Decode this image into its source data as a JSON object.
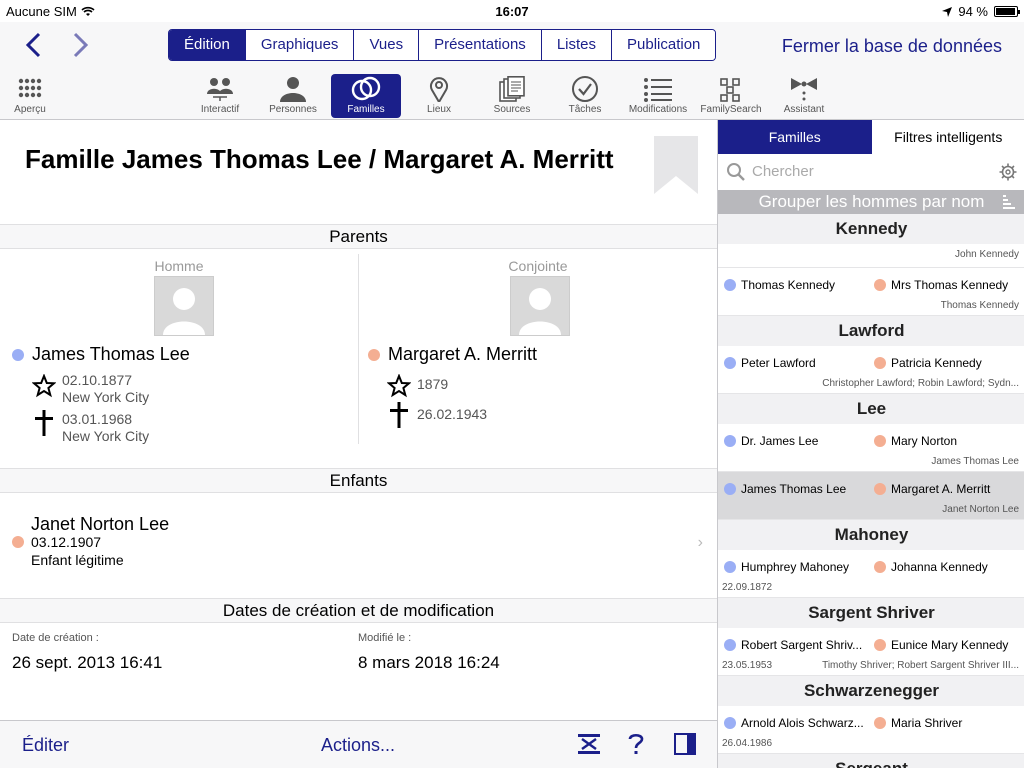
{
  "status": {
    "carrier": "Aucune SIM",
    "time": "16:07",
    "battery": "94 %",
    "battery_level": 0.94
  },
  "nav": {
    "tabs": [
      "Édition",
      "Graphiques",
      "Vues",
      "Présentations",
      "Listes",
      "Publication"
    ],
    "active_tab": 0,
    "close_db": "Fermer la base de données"
  },
  "toolbar": {
    "items": [
      {
        "label": "Aperçu",
        "icon": "grid-icon"
      },
      {
        "label": "Interactif",
        "icon": "interactive-tree-icon"
      },
      {
        "label": "Personnes",
        "icon": "person-icon"
      },
      {
        "label": "Familles",
        "icon": "rings-icon"
      },
      {
        "label": "Lieux",
        "icon": "map-pin-icon"
      },
      {
        "label": "Sources",
        "icon": "sources-icon"
      },
      {
        "label": "Tâches",
        "icon": "checkmark-icon"
      },
      {
        "label": "Modifications",
        "icon": "list-icon"
      },
      {
        "label": "FamilySearch",
        "icon": "familysearch-icon"
      },
      {
        "label": "Assistant",
        "icon": "assistant-icon"
      }
    ],
    "active": 3
  },
  "detail": {
    "title": "Famille James Thomas Lee / Margaret A. Merritt",
    "parents_header": "Parents",
    "husband": {
      "role": "Homme",
      "name": "James Thomas Lee",
      "birth_date": "02.10.1877",
      "birth_place": "New York City",
      "death_date": "03.01.1968",
      "death_place": "New York City"
    },
    "wife": {
      "role": "Conjointe",
      "name": "Margaret A. Merritt",
      "birth_date": "1879",
      "death_date": "26.02.1943"
    },
    "children_header": "Enfants",
    "child": {
      "name": "Janet Norton Lee",
      "date": "03.12.1907",
      "relation": "Enfant légitime"
    },
    "dates_header": "Dates de création et de modification",
    "created_label": "Date de création :",
    "created_value": "26 sept. 2013 16:41",
    "modified_label": "Modifié le :",
    "modified_value": "8 mars 2018 16:24"
  },
  "bottom": {
    "edit": "Éditer",
    "actions": "Actions..."
  },
  "sidebar": {
    "tabs": [
      "Familles",
      "Filtres intelligents"
    ],
    "active_tab": 0,
    "search_placeholder": "Chercher",
    "group_by": "Grouper les hommes par nom",
    "groups": [
      {
        "name": "Kennedy",
        "leading_kids": "John Kennedy",
        "rows": [
          {
            "husband": "Thomas Kennedy",
            "wife": "Mrs Thomas Kennedy",
            "kids": "Thomas Kennedy",
            "date": "",
            "selected": false
          }
        ]
      },
      {
        "name": "Lawford",
        "leading_kids": "",
        "rows": [
          {
            "husband": "Peter Lawford",
            "wife": "Patricia Kennedy",
            "kids": "Christopher Lawford; Robin Lawford; Sydn...",
            "date": "",
            "selected": false
          }
        ]
      },
      {
        "name": "Lee",
        "leading_kids": "",
        "rows": [
          {
            "husband": "Dr. James Lee",
            "wife": "Mary Norton",
            "kids": "James Thomas Lee",
            "date": "",
            "selected": false
          },
          {
            "husband": "James Thomas Lee",
            "wife": "Margaret A. Merritt",
            "kids": "Janet Norton Lee",
            "date": "",
            "selected": true
          }
        ]
      },
      {
        "name": "Mahoney",
        "leading_kids": "",
        "rows": [
          {
            "husband": "Humphrey Mahoney",
            "wife": "Johanna Kennedy",
            "kids": "",
            "date": "22.09.1872",
            "selected": false
          }
        ]
      },
      {
        "name": "Sargent Shriver",
        "leading_kids": "",
        "rows": [
          {
            "husband": "Robert Sargent Shriv...",
            "wife": "Eunice Mary Kennedy",
            "kids": "Timothy Shriver; Robert Sargent Shriver III...",
            "date": "23.05.1953",
            "selected": false
          }
        ]
      },
      {
        "name": "Schwarzenegger",
        "leading_kids": "",
        "rows": [
          {
            "husband": "Arnold Alois Schwarz...",
            "wife": "Maria Shriver",
            "kids": "",
            "date": "26.04.1986",
            "selected": false
          }
        ]
      },
      {
        "name": "Sergeant",
        "leading_kids": "",
        "rows": []
      }
    ]
  },
  "colors": {
    "accent": "#1b1f8a",
    "male_dot": "#9aaef5",
    "female_dot": "#f4ae92"
  }
}
